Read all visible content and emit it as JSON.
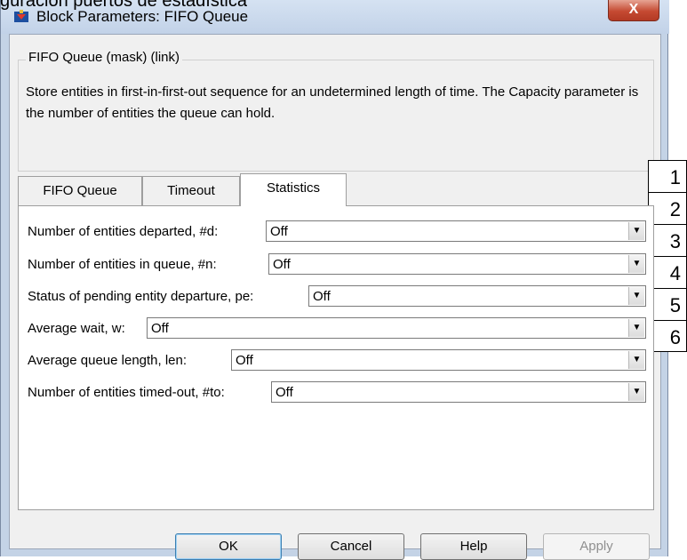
{
  "caption": "guración puertos de estadística",
  "window": {
    "title": "Block Parameters: FIFO Queue",
    "close_label": "X"
  },
  "mask": {
    "legend": "FIFO Queue (mask) (link)",
    "description": "Store entities in first-in-first-out sequence for an undetermined length of time. The Capacity parameter is the number of entities the queue can hold."
  },
  "tabs": [
    {
      "label": "FIFO Queue"
    },
    {
      "label": "Timeout"
    },
    {
      "label": "Statistics",
      "active": true
    }
  ],
  "params": [
    {
      "label": "Number of entities departed, #d:",
      "value": "Off"
    },
    {
      "label": "Number of entities in queue, #n:",
      "value": "Off"
    },
    {
      "label": "Status of pending entity departure, pe:",
      "value": "Off"
    },
    {
      "label": "Average wait, w:",
      "value": "Off"
    },
    {
      "label": "Average queue length, len:",
      "value": "Off"
    },
    {
      "label": "Number of entities timed-out, #to:",
      "value": "Off"
    }
  ],
  "buttons": {
    "ok": "OK",
    "cancel": "Cancel",
    "help": "Help",
    "apply": "Apply"
  },
  "annotations": [
    "1",
    "2",
    "3",
    "4",
    "5",
    "6"
  ],
  "colors": {
    "window_frame": "#c4d3e6",
    "client_bg": "#f0f0f0",
    "close_button": "#c54a32",
    "default_button_border": "#3c7fb1"
  }
}
